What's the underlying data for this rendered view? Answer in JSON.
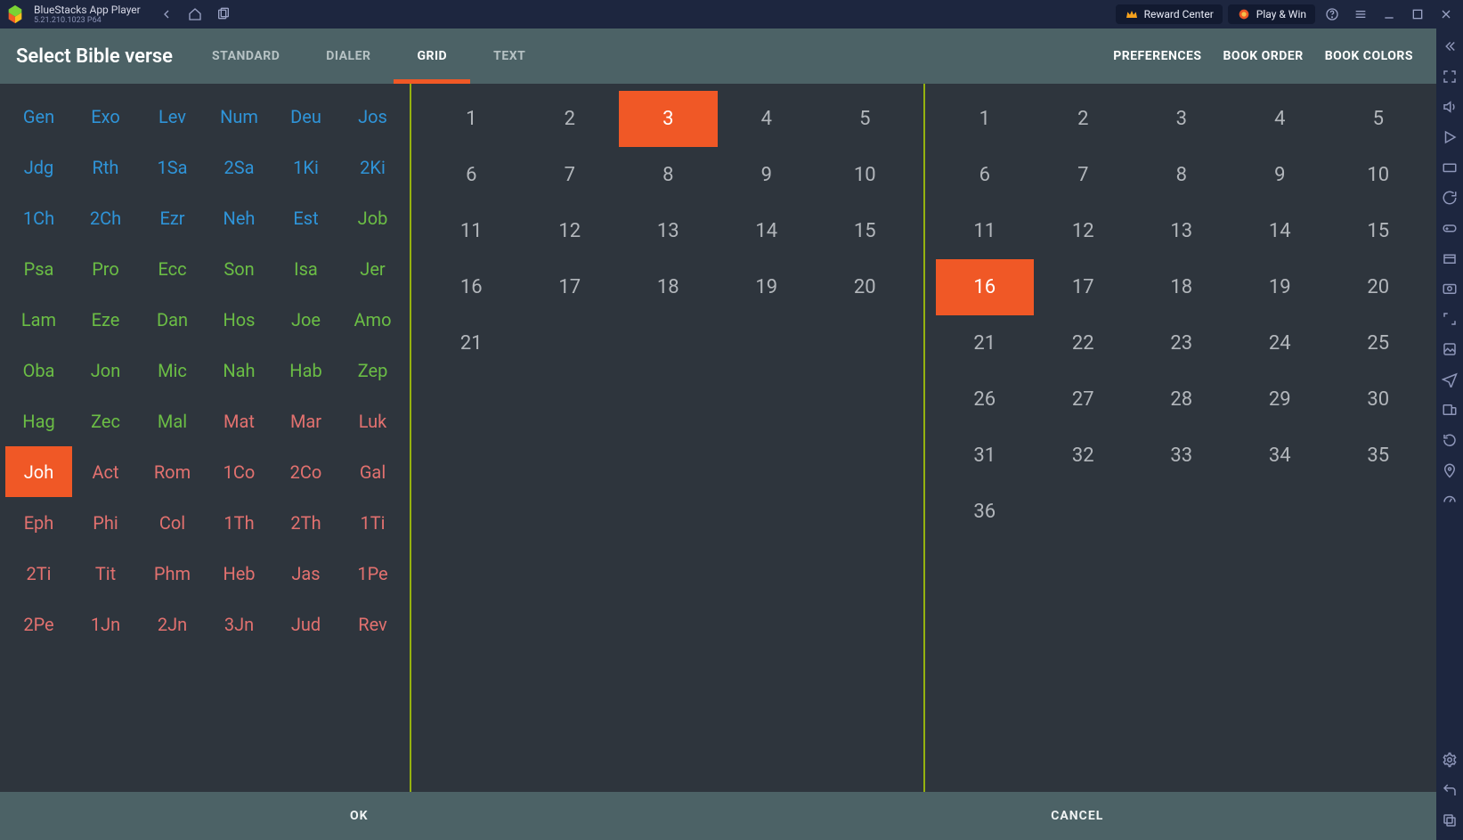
{
  "chrome": {
    "title": "BlueStacks App Player",
    "version": "5.21.210.1023  P64",
    "reward_btn": "Reward Center",
    "play_btn": "Play & Win"
  },
  "app": {
    "title": "Select Bible verse",
    "tabs": [
      "STANDARD",
      "DIALER",
      "GRID",
      "TEXT"
    ],
    "active_tab": 2,
    "links": [
      "PREFERENCES",
      "BOOK ORDER",
      "BOOK COLORS"
    ],
    "books": [
      {
        "abbr": "Gen",
        "cls": "c-torah"
      },
      {
        "abbr": "Exo",
        "cls": "c-torah"
      },
      {
        "abbr": "Lev",
        "cls": "c-torah"
      },
      {
        "abbr": "Num",
        "cls": "c-torah"
      },
      {
        "abbr": "Deu",
        "cls": "c-torah"
      },
      {
        "abbr": "Jos",
        "cls": "c-hist"
      },
      {
        "abbr": "Jdg",
        "cls": "c-hist"
      },
      {
        "abbr": "Rth",
        "cls": "c-hist"
      },
      {
        "abbr": "1Sa",
        "cls": "c-hist"
      },
      {
        "abbr": "2Sa",
        "cls": "c-hist"
      },
      {
        "abbr": "1Ki",
        "cls": "c-hist"
      },
      {
        "abbr": "2Ki",
        "cls": "c-hist"
      },
      {
        "abbr": "1Ch",
        "cls": "c-hist"
      },
      {
        "abbr": "2Ch",
        "cls": "c-hist"
      },
      {
        "abbr": "Ezr",
        "cls": "c-hist"
      },
      {
        "abbr": "Neh",
        "cls": "c-hist"
      },
      {
        "abbr": "Est",
        "cls": "c-hist"
      },
      {
        "abbr": "Job",
        "cls": "c-wis"
      },
      {
        "abbr": "Psa",
        "cls": "c-wis"
      },
      {
        "abbr": "Pro",
        "cls": "c-wis"
      },
      {
        "abbr": "Ecc",
        "cls": "c-wis"
      },
      {
        "abbr": "Son",
        "cls": "c-wis"
      },
      {
        "abbr": "Isa",
        "cls": "c-proph"
      },
      {
        "abbr": "Jer",
        "cls": "c-proph"
      },
      {
        "abbr": "Lam",
        "cls": "c-proph"
      },
      {
        "abbr": "Eze",
        "cls": "c-proph"
      },
      {
        "abbr": "Dan",
        "cls": "c-proph"
      },
      {
        "abbr": "Hos",
        "cls": "c-proph"
      },
      {
        "abbr": "Joe",
        "cls": "c-proph"
      },
      {
        "abbr": "Amo",
        "cls": "c-proph"
      },
      {
        "abbr": "Oba",
        "cls": "c-proph"
      },
      {
        "abbr": "Jon",
        "cls": "c-proph"
      },
      {
        "abbr": "Mic",
        "cls": "c-proph"
      },
      {
        "abbr": "Nah",
        "cls": "c-proph"
      },
      {
        "abbr": "Hab",
        "cls": "c-proph"
      },
      {
        "abbr": "Zep",
        "cls": "c-proph"
      },
      {
        "abbr": "Hag",
        "cls": "c-proph"
      },
      {
        "abbr": "Zec",
        "cls": "c-proph"
      },
      {
        "abbr": "Mal",
        "cls": "c-proph"
      },
      {
        "abbr": "Mat",
        "cls": "c-gosp"
      },
      {
        "abbr": "Mar",
        "cls": "c-gosp"
      },
      {
        "abbr": "Luk",
        "cls": "c-gosp"
      },
      {
        "abbr": "Joh",
        "cls": "c-gosp",
        "selected": true
      },
      {
        "abbr": "Act",
        "cls": "c-gosp"
      },
      {
        "abbr": "Rom",
        "cls": "c-epis"
      },
      {
        "abbr": "1Co",
        "cls": "c-epis"
      },
      {
        "abbr": "2Co",
        "cls": "c-epis"
      },
      {
        "abbr": "Gal",
        "cls": "c-epis"
      },
      {
        "abbr": "Eph",
        "cls": "c-epis"
      },
      {
        "abbr": "Phi",
        "cls": "c-epis"
      },
      {
        "abbr": "Col",
        "cls": "c-epis"
      },
      {
        "abbr": "1Th",
        "cls": "c-epis"
      },
      {
        "abbr": "2Th",
        "cls": "c-epis"
      },
      {
        "abbr": "1Ti",
        "cls": "c-epis"
      },
      {
        "abbr": "2Ti",
        "cls": "c-epis"
      },
      {
        "abbr": "Tit",
        "cls": "c-epis"
      },
      {
        "abbr": "Phm",
        "cls": "c-epis"
      },
      {
        "abbr": "Heb",
        "cls": "c-epis"
      },
      {
        "abbr": "Jas",
        "cls": "c-epis"
      },
      {
        "abbr": "1Pe",
        "cls": "c-epis"
      },
      {
        "abbr": "2Pe",
        "cls": "c-epis"
      },
      {
        "abbr": "1Jn",
        "cls": "c-epis"
      },
      {
        "abbr": "2Jn",
        "cls": "c-epis"
      },
      {
        "abbr": "3Jn",
        "cls": "c-epis"
      },
      {
        "abbr": "Jud",
        "cls": "c-epis"
      },
      {
        "abbr": "Rev",
        "cls": "c-epis"
      }
    ],
    "chapters": {
      "count": 21,
      "selected": 3
    },
    "verses": {
      "count": 36,
      "selected": 16
    },
    "ok": "OK",
    "cancel": "CANCEL"
  }
}
